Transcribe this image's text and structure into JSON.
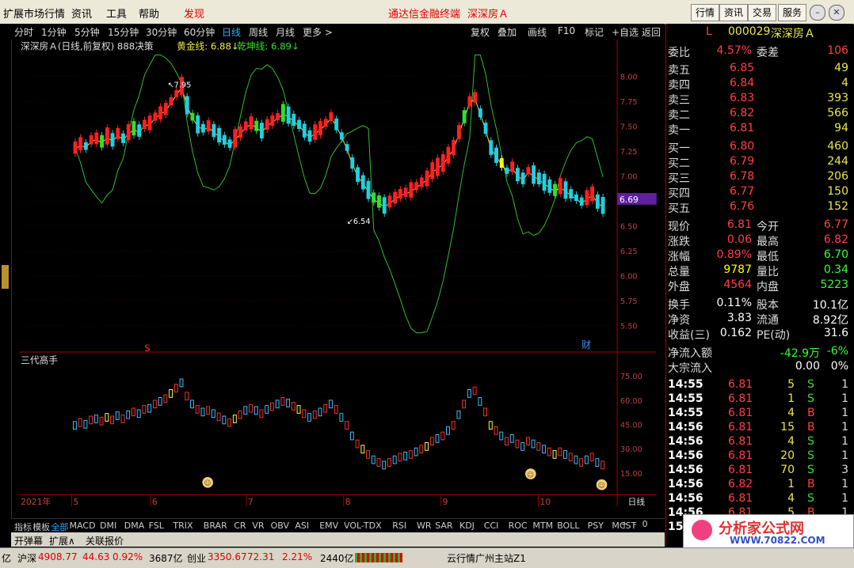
{
  "menu": {
    "items": [
      "扩展市场行情",
      "资讯",
      "工具",
      "帮助",
      "发现"
    ],
    "center_title": "通达信金融终端",
    "stock_name_top": "深深房Ａ",
    "right_buttons": [
      "行情",
      "资讯",
      "交易",
      "服务"
    ]
  },
  "periods": [
    "分时",
    "1分钟",
    "5分钟",
    "15分钟",
    "30分钟",
    "60分钟",
    "日线",
    "周线",
    "月线",
    "更多 >"
  ],
  "period_active": "日线",
  "chart_tools": [
    "复权",
    "叠加",
    "画线",
    "F10",
    "标记",
    "+自选",
    "返回"
  ],
  "chart_title": {
    "name": "深深房Ａ(日线,前复权) 888决策",
    "gold_label": "黄金线: 6.88↓",
    "qk_label": "乾坤线: 6.89↓"
  },
  "price_axis": [
    "8.00",
    "7.75",
    "7.50",
    "7.25",
    "7.00",
    "6.75",
    "6.50",
    "6.25",
    "6.00",
    "5.75",
    "5.50"
  ],
  "annotations": {
    "high": "7.95",
    "low": "6.54",
    "last": "6.69",
    "marker_s": "S",
    "marker_cai": "财"
  },
  "indicator": {
    "name": "三代高手",
    "axis": [
      "75.00",
      "60.00",
      "45.00",
      "30.00",
      "15.00"
    ]
  },
  "date_axis": {
    "year": "2021年",
    "months": [
      "5",
      "6",
      "7",
      "8",
      "9",
      "10"
    ],
    "period": "日线"
  },
  "indicator_tabs": [
    "指标",
    "模板",
    "全部",
    "MACD",
    "DMI",
    "DMA",
    "FSL",
    "TRIX",
    "BRAR",
    "CR",
    "VR",
    "OBV",
    "ASI",
    "EMV",
    "VOL-TDX",
    "RSI",
    "WR",
    "SAR",
    "KDJ",
    "CCI",
    "ROC",
    "MTM",
    "BOLL",
    "PSY",
    "MCST"
  ],
  "indicator_tab_active": "全部",
  "bottom_tabs": [
    "开弹幕",
    "扩展∧",
    "关联报价"
  ],
  "watermark": "分析家公式网 www.70822.com",
  "quote": {
    "code": "000029",
    "name": "深深房Ａ",
    "flag": "L",
    "weibi_label": "委比",
    "weibi": "4.57%",
    "weicha_label": "委差",
    "weicha": "106",
    "sell": [
      {
        "label": "卖五",
        "price": "6.85",
        "vol": "49"
      },
      {
        "label": "卖四",
        "price": "6.84",
        "vol": "4"
      },
      {
        "label": "卖三",
        "price": "6.83",
        "vol": "393"
      },
      {
        "label": "卖二",
        "price": "6.82",
        "vol": "566"
      },
      {
        "label": "卖一",
        "price": "6.81",
        "vol": "94"
      }
    ],
    "buy": [
      {
        "label": "买一",
        "price": "6.80",
        "vol": "460"
      },
      {
        "label": "买二",
        "price": "6.79",
        "vol": "244"
      },
      {
        "label": "买三",
        "price": "6.78",
        "vol": "206"
      },
      {
        "label": "买四",
        "price": "6.77",
        "vol": "150"
      },
      {
        "label": "买五",
        "price": "6.76",
        "vol": "152"
      }
    ],
    "stats": [
      {
        "l1": "现价",
        "v1": "6.81",
        "l2": "今开",
        "v2": "6.77",
        "c1": "#ff4040",
        "c2": "#ff4040"
      },
      {
        "l1": "涨跌",
        "v1": "0.06",
        "l2": "最高",
        "v2": "6.82",
        "c1": "#ff4040",
        "c2": "#ff4040"
      },
      {
        "l1": "涨幅",
        "v1": "0.89%",
        "l2": "最低",
        "v2": "6.70",
        "c1": "#ff4040",
        "c2": "#33ff33"
      },
      {
        "l1": "总量",
        "v1": "9787",
        "l2": "量比",
        "v2": "0.34",
        "c1": "#ffff00",
        "c2": "#33ff33"
      },
      {
        "l1": "外盘",
        "v1": "4564",
        "l2": "内盘",
        "v2": "5223",
        "c1": "#ff4040",
        "c2": "#33ff33"
      }
    ],
    "fin": [
      {
        "l1": "换手",
        "v1": "0.11%",
        "l2": "股本",
        "v2": "10.1亿"
      },
      {
        "l1": "净资",
        "v1": "3.83",
        "l2": "流通",
        "v2": "8.92亿"
      },
      {
        "l1": "收益(三)",
        "v1": "0.162",
        "l2": "PE(动)",
        "v2": "31.6"
      }
    ],
    "flow": [
      {
        "label": "净流入额",
        "v1": "-42.9万",
        "v2": "-6%",
        "color": "#33ff33"
      },
      {
        "label": "大宗流入",
        "v1": "0.00",
        "v2": "0%",
        "color": "#ffffff"
      }
    ],
    "ticks": [
      {
        "time": "14:55",
        "price": "6.81",
        "vol": "5",
        "side": "S",
        "n": "1"
      },
      {
        "time": "14:55",
        "price": "6.81",
        "vol": "1",
        "side": "S",
        "n": "1"
      },
      {
        "time": "14:55",
        "price": "6.81",
        "vol": "4",
        "side": "B",
        "n": "1"
      },
      {
        "time": "14:56",
        "price": "6.81",
        "vol": "15",
        "side": "B",
        "n": "1"
      },
      {
        "time": "14:56",
        "price": "6.81",
        "vol": "4",
        "side": "S",
        "n": "1"
      },
      {
        "time": "14:56",
        "price": "6.81",
        "vol": "20",
        "side": "S",
        "n": "1"
      },
      {
        "time": "14:56",
        "price": "6.81",
        "vol": "70",
        "side": "S",
        "n": "3"
      },
      {
        "time": "14:56",
        "price": "6.82",
        "vol": "1",
        "side": "B",
        "n": "1"
      },
      {
        "time": "14:56",
        "price": "6.81",
        "vol": "4",
        "side": "S",
        "n": "1"
      },
      {
        "time": "14:56",
        "price": "6.81",
        "vol": "5",
        "side": "B",
        "n": "1"
      }
    ],
    "last_time": "15:0"
  },
  "status": {
    "prefix": "亿",
    "sh_label": "沪深",
    "sh_val": "4908.77",
    "sh_chg": "44.63",
    "sh_pct": "0.92%",
    "sh_amt": "3687亿",
    "cy_label": "创业",
    "cy_val": "3350.67",
    "cy_chg": "72.31",
    "cy_pct": "2.21%",
    "cy_amt": "2440亿",
    "server": "云行情广州主站Z1"
  },
  "logo": {
    "title": "分析家公式网",
    "url": "WWW.70822.COM"
  },
  "colors": {
    "up": "#ff2020",
    "down": "#20d0e0",
    "gold": "#e8e850",
    "qk": "#30e030",
    "accent": "#3aa0ff"
  }
}
